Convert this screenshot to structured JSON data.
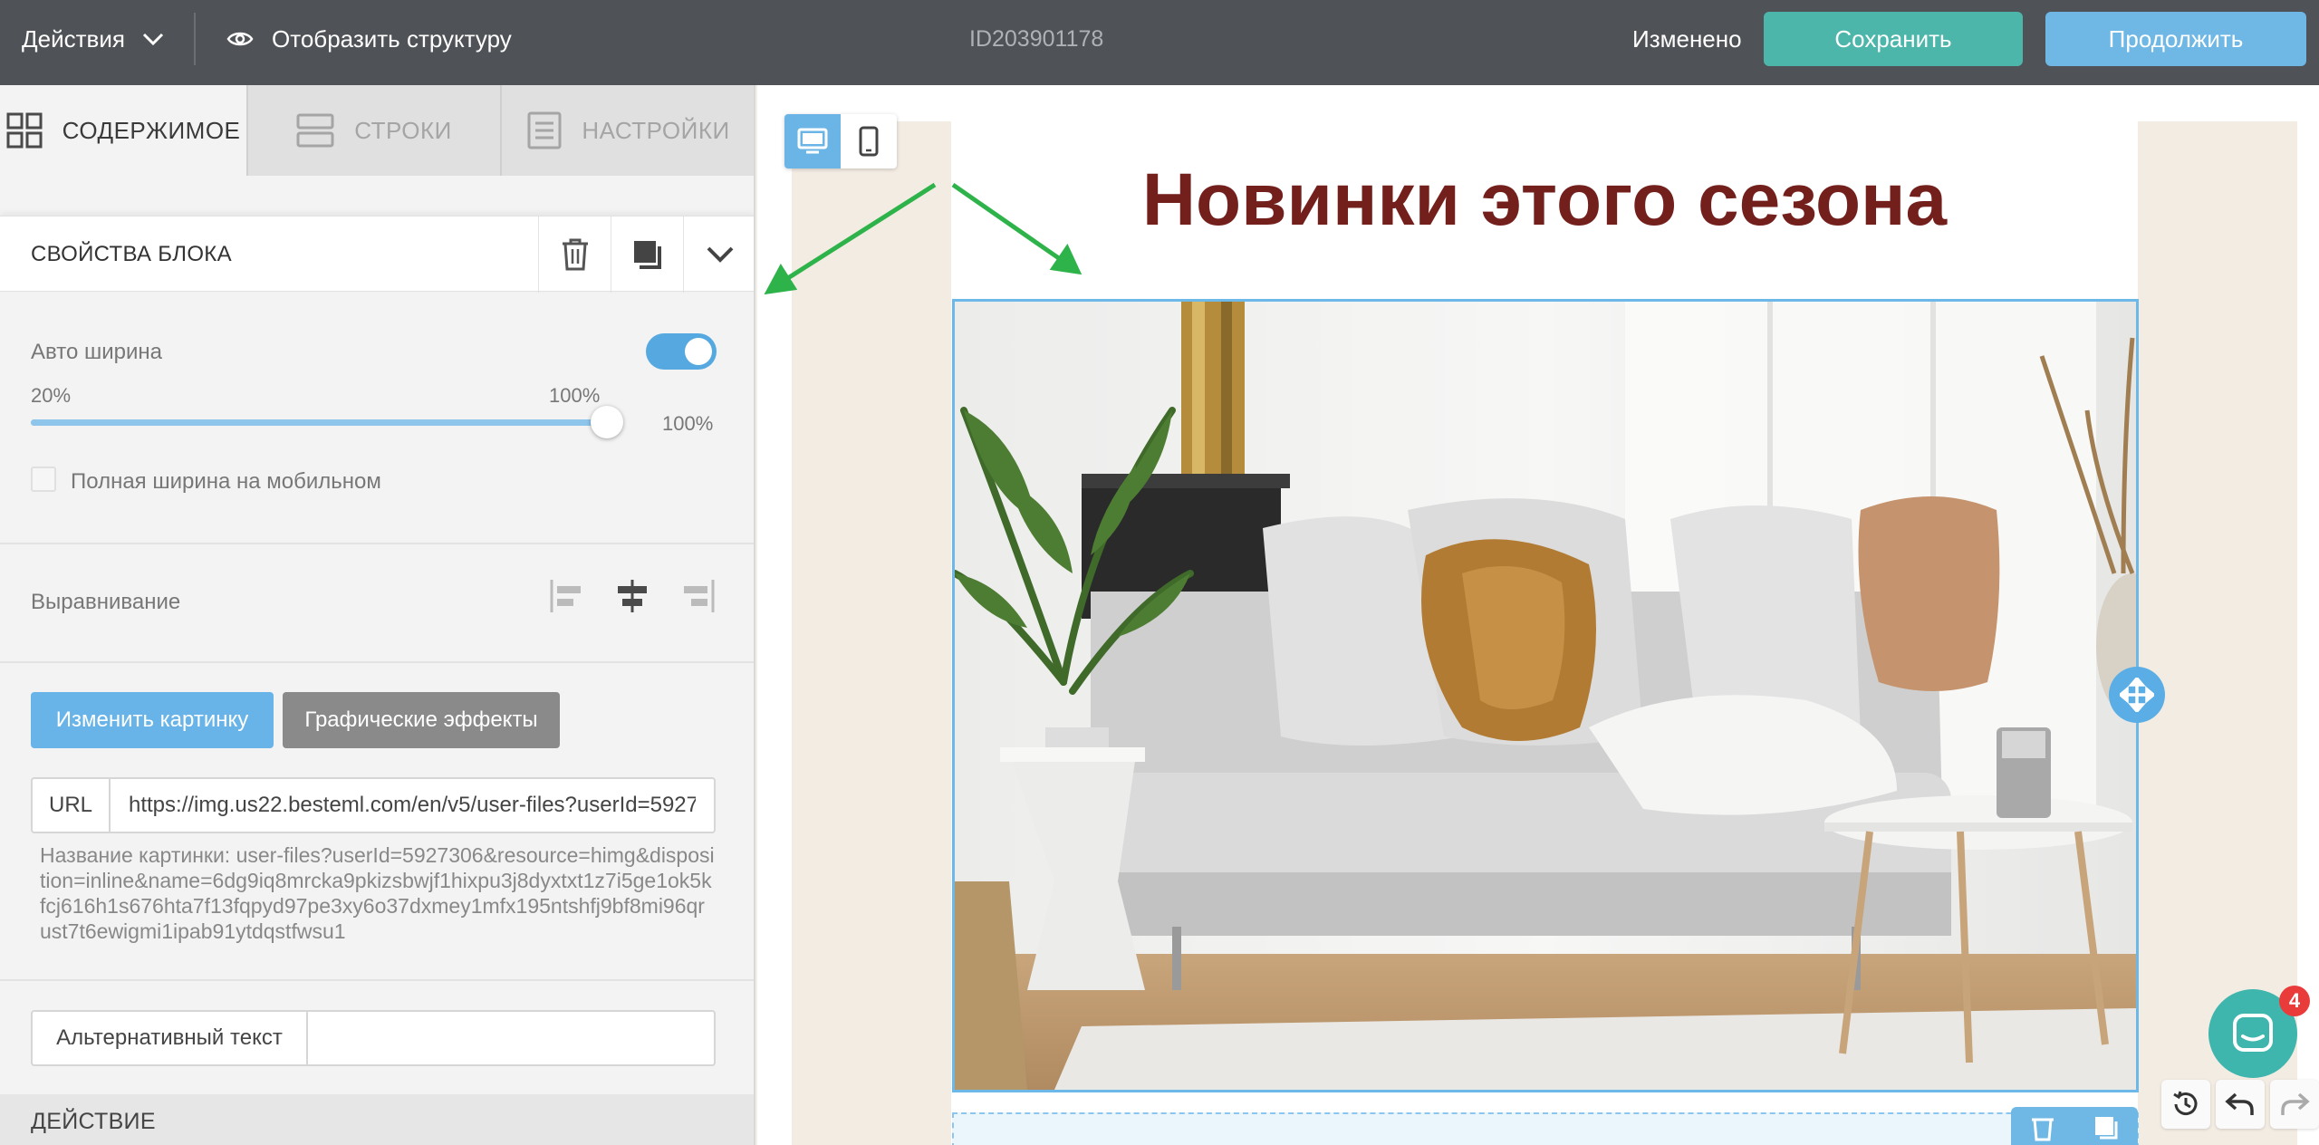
{
  "topbar": {
    "actions_label": "Действия",
    "structure_label": "Отобразить структуру",
    "doc_id": "ID203901178",
    "status": "Изменено",
    "save_label": "Сохранить",
    "continue_label": "Продолжить"
  },
  "tabs": [
    {
      "label": "СОДЕРЖИМОЕ",
      "icon": "grid-icon",
      "active": true
    },
    {
      "label": "СТРОКИ",
      "icon": "rows-icon",
      "active": false
    },
    {
      "label": "НАСТРОЙКИ",
      "icon": "settings-list-icon",
      "active": false
    }
  ],
  "block_props": {
    "title": "СВОЙСТВА БЛОКА",
    "auto_width_label": "Авто ширина",
    "auto_width_on": true,
    "slider_min": "20%",
    "slider_max": "100%",
    "slider_value": "100%",
    "slider_fraction": 1.0,
    "full_width_mobile_label": "Полная ширина на мобильном",
    "alignment_label": "Выравнивание",
    "change_image_label": "Изменить картинку",
    "effects_label": "Графические эффекты",
    "url_label": "URL",
    "url_value": "https://img.us22.besteml.com/en/v5/user-files?userId=5927306&resource=himg&disposition=inline&name=6dg9iq8mrcka9pkizsbwjf1hixpu3j8dyxtxt1z7i5ge1ok5kfcj616h1s676hta7f13fqpyd97pe3xy6o37dxmey1mfx195ntshfj9bf8mi96qrust7t6ewigmi1ipab91ytdqstfwsu1",
    "image_name": "Название картинки:  user-files?userId=5927306&resource=himg&disposition=inline&name=6dg9iq8mrcka9pkizsbwjf1hixpu3j8dyxtxt1z7i5ge1ok5kfcj616h1s676hta7f13fqpyd97pe3xy6o37dxmey1mfx195ntshfj9bf8mi96qrust7t6ewigmi1ipab91ytdqstfwsu1",
    "alt_label": "Альтернативный текст",
    "alt_value": "",
    "action_title": "ДЕЙСТВИЕ"
  },
  "canvas": {
    "headline": "Новинки этого сезона"
  },
  "chat": {
    "badge": "4"
  },
  "colors": {
    "topbar": "#4f5357",
    "save": "#4db6aa",
    "continue": "#6fb8e6",
    "headline": "#73201d",
    "selection": "#6cb8e8",
    "arrow": "#2eb34a"
  }
}
